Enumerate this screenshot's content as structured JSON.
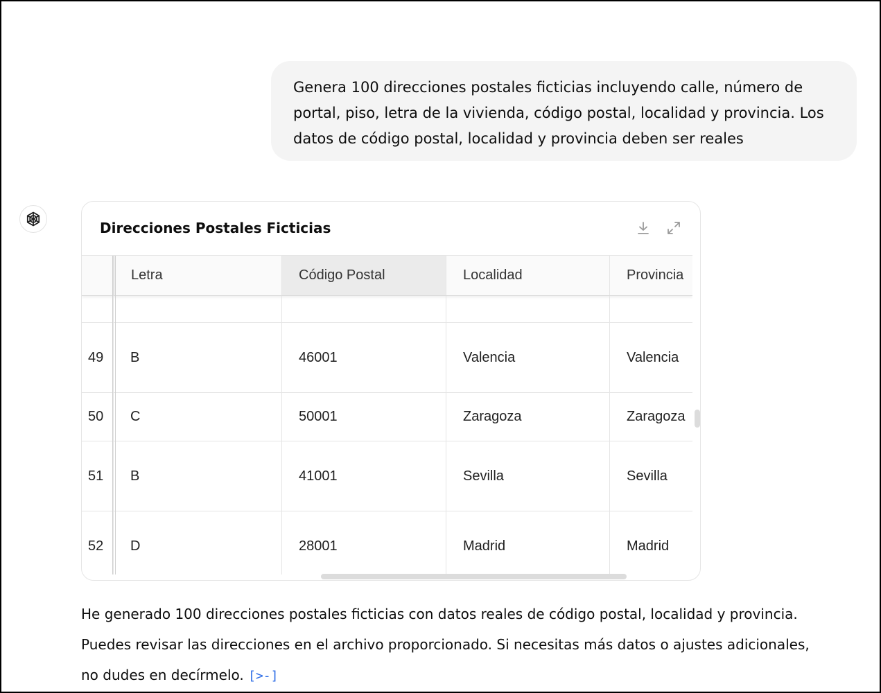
{
  "user_message": "Genera 100 direcciones postales ficticias incluyendo calle, número de portal, piso, letra de la vivienda, código postal, localidad y provincia. Los datos de código postal, localidad y provincia deben ser reales",
  "assistant_icon": "openai-logo-icon",
  "table": {
    "title": "Direcciones Postales Ficticias",
    "download_icon": "download-icon",
    "expand_icon": "expand-icon",
    "columns": [
      "Letra",
      "Código Postal",
      "Localidad",
      "Provincia"
    ],
    "rows": [
      {
        "index": "49",
        "letra": "B",
        "codigo_postal": "46001",
        "localidad": "Valencia",
        "provincia": "Valencia"
      },
      {
        "index": "50",
        "letra": "C",
        "codigo_postal": "50001",
        "localidad": "Zaragoza",
        "provincia": "Zaragoza"
      },
      {
        "index": "51",
        "letra": "B",
        "codigo_postal": "41001",
        "localidad": "Sevilla",
        "provincia": "Sevilla"
      },
      {
        "index": "52",
        "letra": "D",
        "codigo_postal": "28001",
        "localidad": "Madrid",
        "provincia": "Madrid"
      }
    ]
  },
  "reply": {
    "text": "He generado 100 direcciones postales ficticias con datos reales de código postal, localidad y provincia. Puedes revisar las direcciones en el archivo proporcionado. Si necesitas más datos o ajustes adicionales, no dudes en decírmelo.",
    "source_link": "[>-]"
  }
}
